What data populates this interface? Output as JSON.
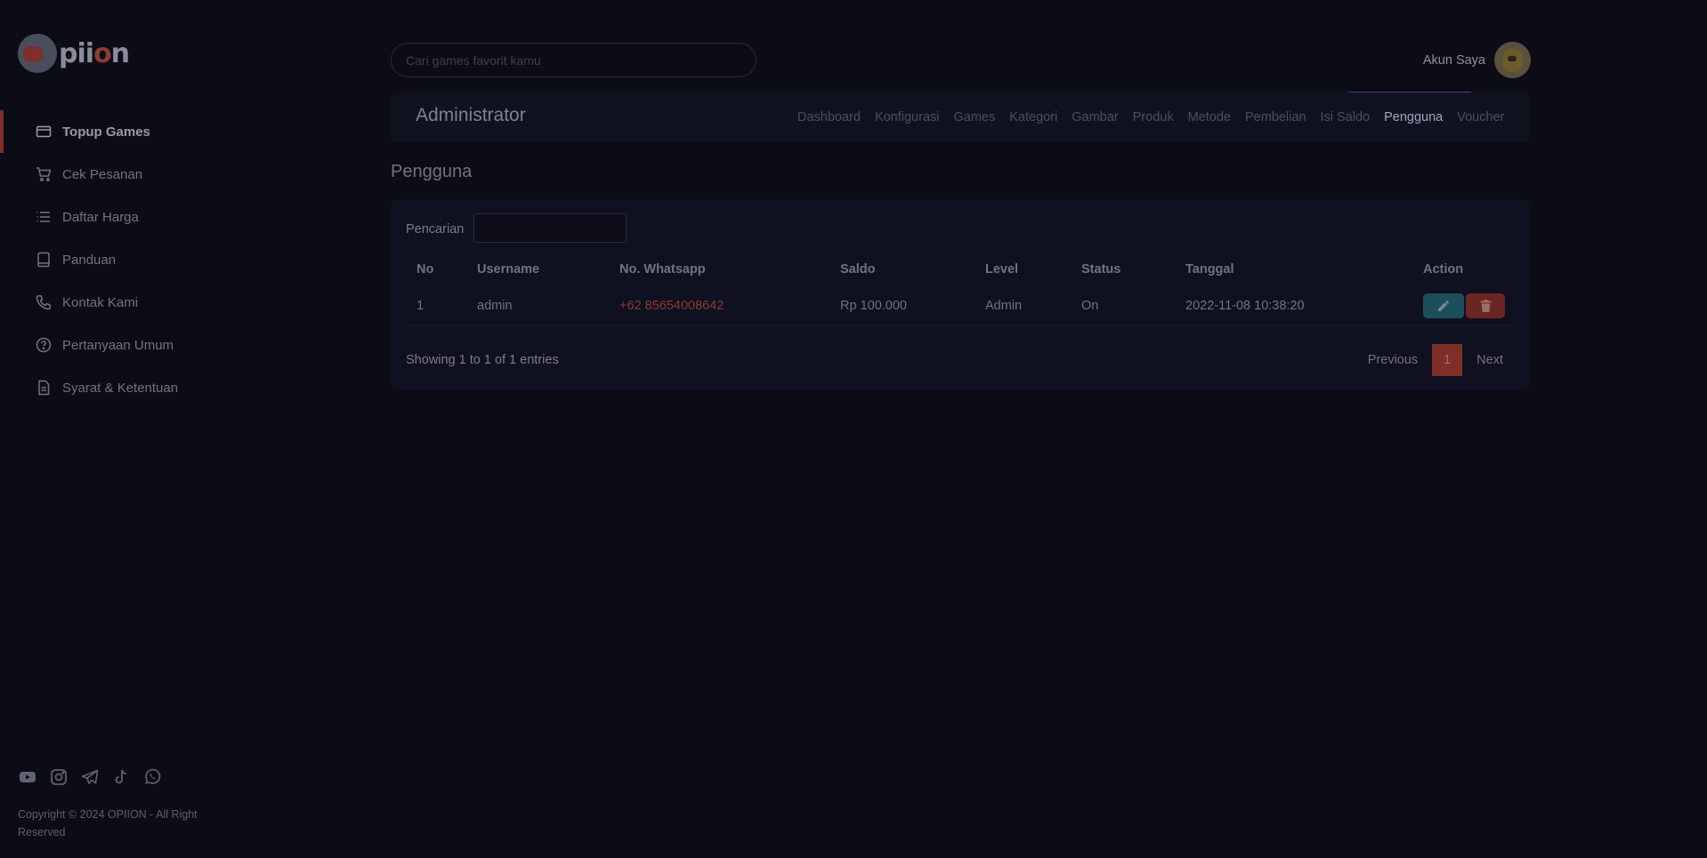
{
  "brand": {
    "name_prefix": "pii",
    "name_accent": "o",
    "name_suffix": "n"
  },
  "sidebar": {
    "items": [
      {
        "label": "Topup Games",
        "icon": "credit-card-icon",
        "active": true
      },
      {
        "label": "Cek Pesanan",
        "icon": "cart-icon",
        "active": false
      },
      {
        "label": "Daftar Harga",
        "icon": "list-icon",
        "active": false
      },
      {
        "label": "Panduan",
        "icon": "book-icon",
        "active": false
      },
      {
        "label": "Kontak Kami",
        "icon": "phone-icon",
        "active": false
      },
      {
        "label": "Pertanyaan Umum",
        "icon": "question-circle-icon",
        "active": false
      },
      {
        "label": "Syarat & Ketentuan",
        "icon": "document-icon",
        "active": false
      }
    ],
    "social": [
      "youtube-icon",
      "instagram-icon",
      "telegram-icon",
      "tiktok-icon",
      "whatsapp-icon"
    ],
    "copyright": "Copyright © 2024 OPIION - All Right Reserved"
  },
  "header": {
    "search_placeholder": "Cari games favorit kamu",
    "account_label": "Akun Saya"
  },
  "admin": {
    "title": "Administrator",
    "tabs": [
      "Dashboard",
      "Konfigurasi",
      "Games",
      "Kategori",
      "Gambar",
      "Produk",
      "Metode",
      "Pembelian",
      "Isi Saldo",
      "Pengguna",
      "Voucher"
    ],
    "active_tab": "Pengguna"
  },
  "page": {
    "title": "Pengguna",
    "search_label": "Pencarian",
    "columns": [
      "No",
      "Username",
      "No. Whatsapp",
      "Saldo",
      "Level",
      "Status",
      "Tanggal",
      "Action"
    ],
    "rows": [
      [
        "1",
        "admin",
        "+62 85654008642",
        "Rp 100.000",
        "Admin",
        "On",
        "2022-11-08 10:38:20"
      ]
    ],
    "info": "Showing 1 to 1 of 1 entries",
    "pagination": {
      "previous": "Previous",
      "current": "1",
      "next": "Next"
    }
  },
  "colors": {
    "background": "#0c0c17",
    "accent": "#7d2f28",
    "active_tab_bg": "#3f3f6e"
  }
}
